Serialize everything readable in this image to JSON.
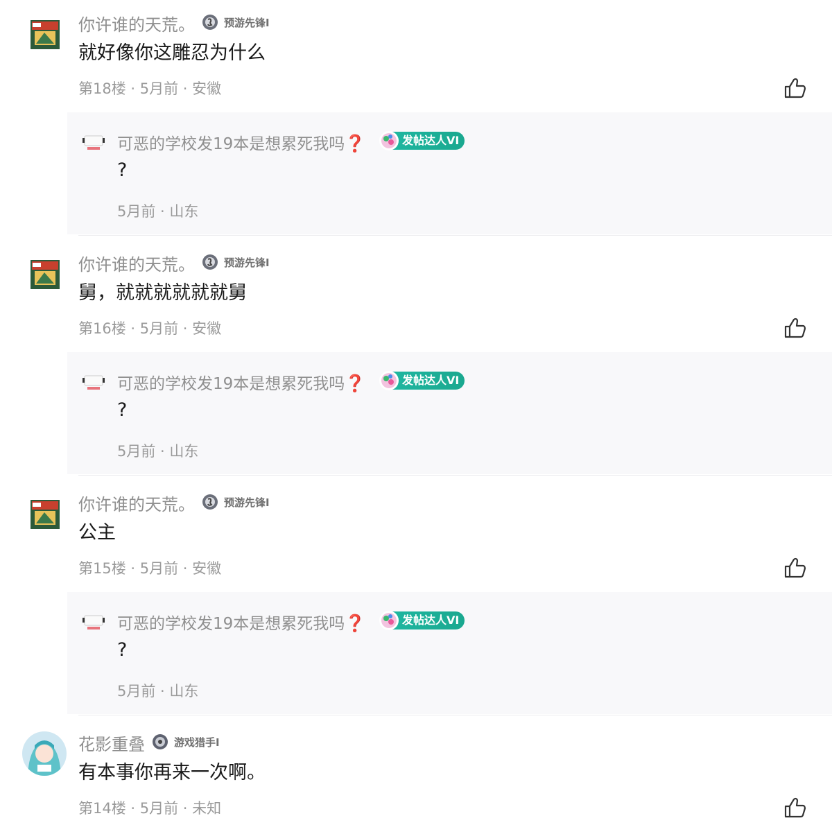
{
  "comments": [
    {
      "author": "你许谁的天荒。",
      "badge": "预游先锋I",
      "content": "就好像你这雕忍为什么",
      "meta": "第18楼 · 5月前 · 安徽",
      "reply": {
        "author": "可恶的学校发19本是想累死我吗",
        "author_suffix": "❓",
        "badge": "发帖达人VI",
        "content": "?",
        "meta": "5月前 · 山东"
      }
    },
    {
      "author": "你许谁的天荒。",
      "badge": "预游先锋I",
      "content": "舅，就就就就就就舅",
      "meta": "第16楼 · 5月前 · 安徽",
      "reply": {
        "author": "可恶的学校发19本是想累死我吗",
        "author_suffix": "❓",
        "badge": "发帖达人VI",
        "content": "?",
        "meta": "5月前 · 山东"
      }
    },
    {
      "author": "你许谁的天荒。",
      "badge": "预游先锋I",
      "content": "公主",
      "meta": "第15楼 · 5月前 · 安徽",
      "reply": {
        "author": "可恶的学校发19本是想累死我吗",
        "author_suffix": "❓",
        "badge": "发帖达人VI",
        "content": "?",
        "meta": "5月前 · 山东"
      }
    },
    {
      "author": "花影重叠",
      "badge": "游戏猎手I",
      "content": "有本事你再来一次啊。",
      "meta": "第14楼 · 5月前 · 未知"
    }
  ],
  "colors": {
    "reply_badge_green": "#1fb9a3",
    "meta_gray": "#9a9a9a",
    "author_gray": "#8f8f8f",
    "question_red": "#e8747c"
  }
}
